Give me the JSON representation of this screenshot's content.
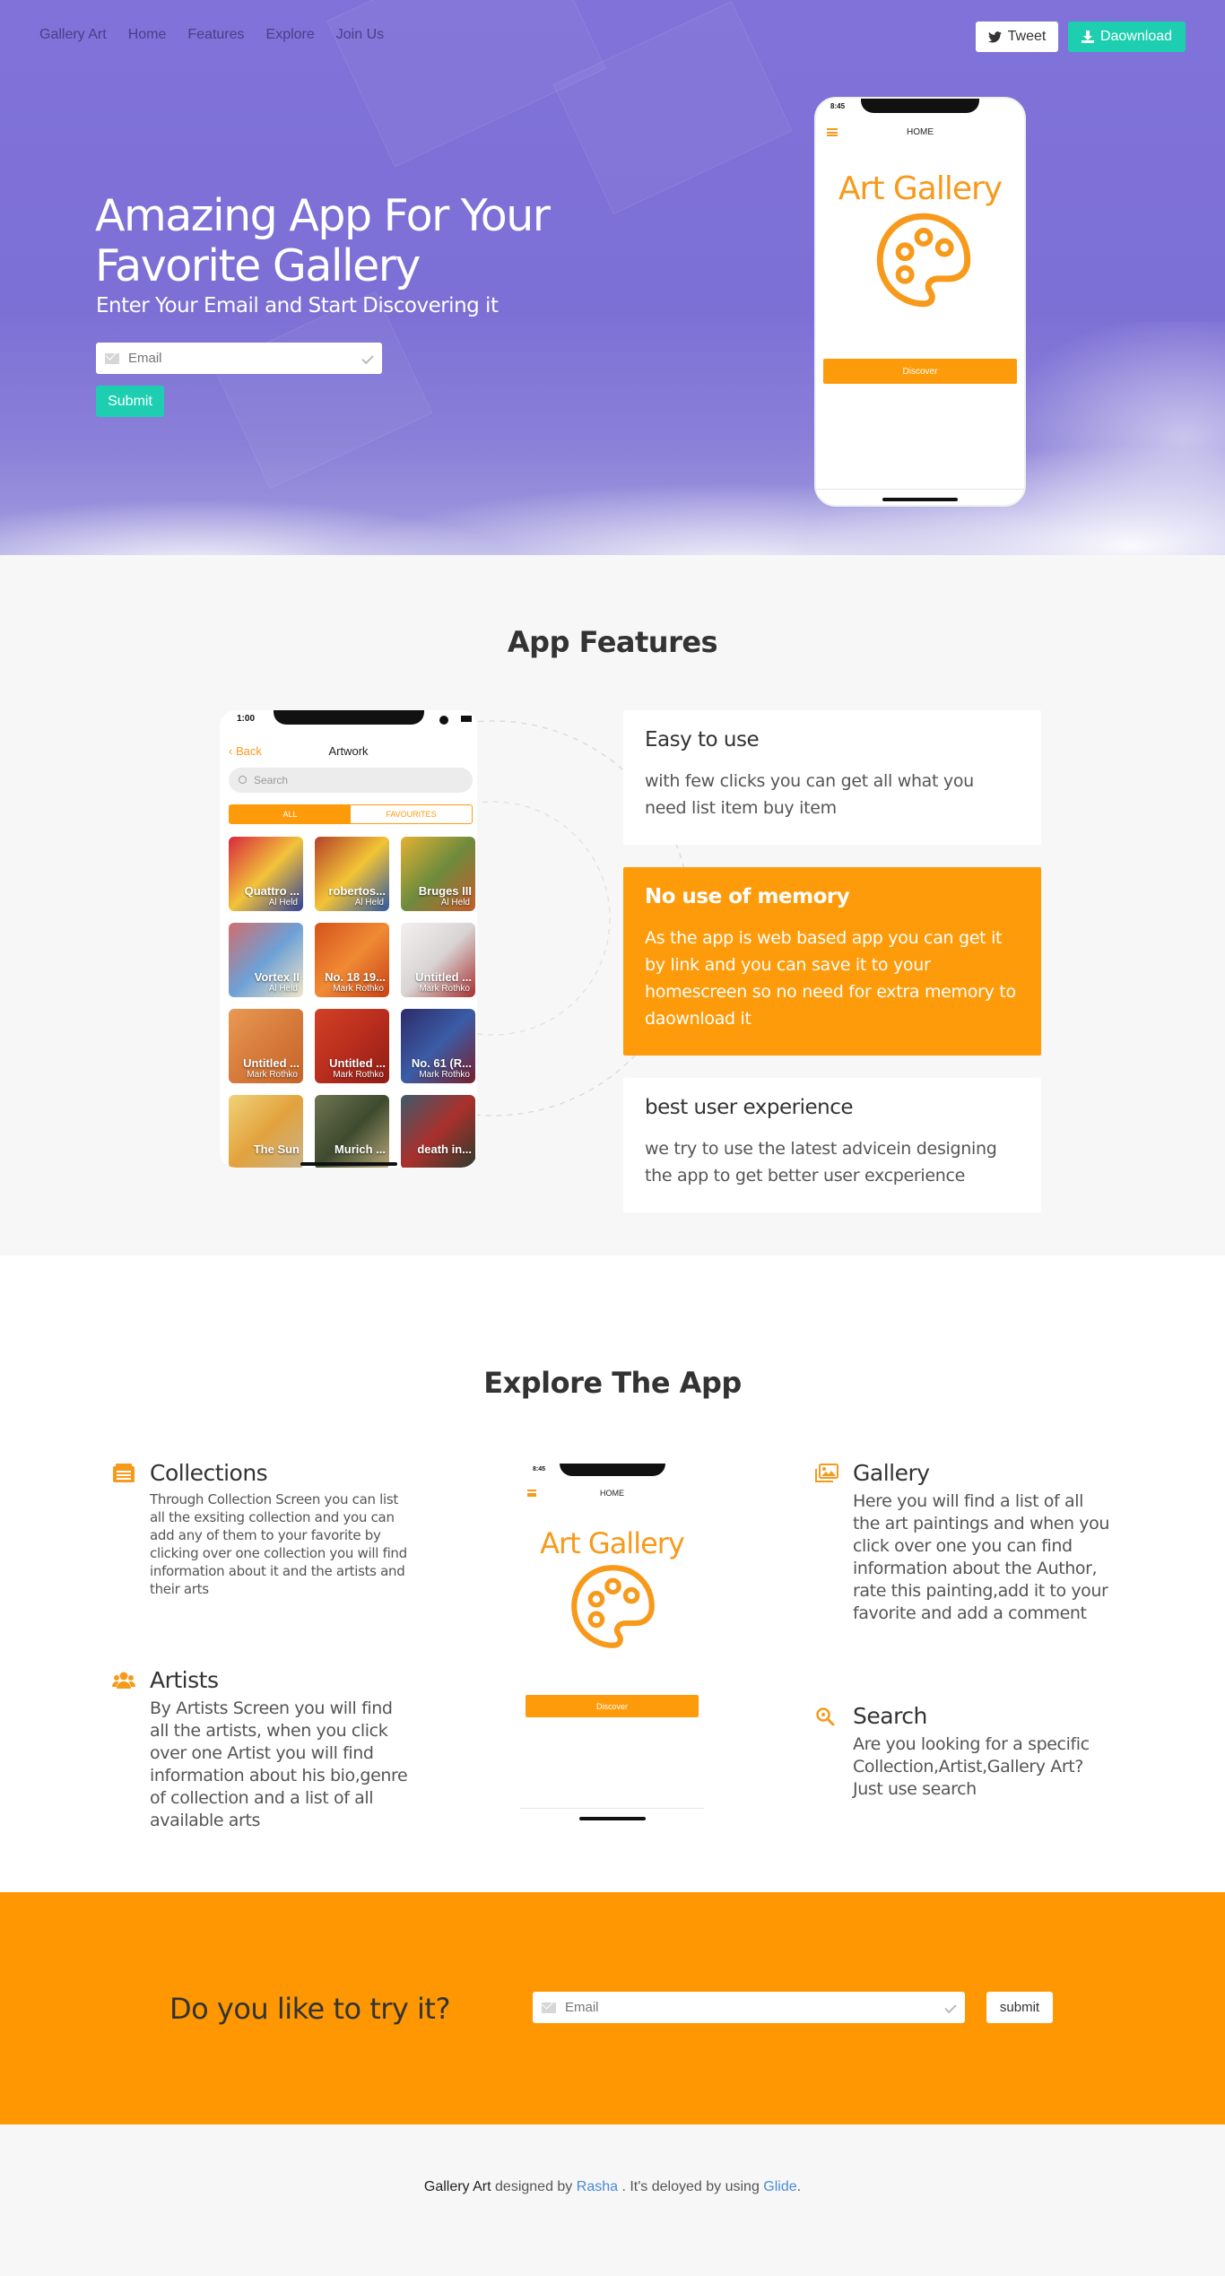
{
  "nav": {
    "brand": "Gallery Art",
    "links": [
      "Home",
      "Features",
      "Explore",
      "Join Us"
    ],
    "tweet_label": "Tweet",
    "download_label": "Daownload"
  },
  "hero": {
    "title": "Amazing App For Your Favorite Gallery",
    "subtitle": "Enter Your Email and Start Discovering it",
    "email_placeholder": "Email",
    "submit_label": "Submit",
    "phone": {
      "time": "8:45",
      "screen_title": "HOME",
      "brand": "Art Gallery",
      "button_label": "Discover"
    }
  },
  "features": {
    "title": "App Features",
    "phone": {
      "time": "1:00",
      "back_label": "Back",
      "screen_title": "Artwork",
      "search_placeholder": "Search",
      "segments": [
        "ALL",
        "FAVOURITES"
      ],
      "tiles": [
        {
          "title": "Quattro ...",
          "artist": "Al Held",
          "colors": [
            "#d7283c",
            "#f2c33a",
            "#2f3f9c"
          ]
        },
        {
          "title": "robertos...",
          "artist": "Al Held",
          "colors": [
            "#b4422a",
            "#f3c436",
            "#2d57a3"
          ]
        },
        {
          "title": "Bruges III",
          "artist": "Al Held",
          "colors": [
            "#e1b233",
            "#6e8b3d",
            "#c65b2b"
          ]
        },
        {
          "title": "Vortex II",
          "artist": "Al Held",
          "colors": [
            "#d06e6e",
            "#6da0d6",
            "#f0e6c6"
          ]
        },
        {
          "title": "No. 18 19...",
          "artist": "Mark Rothko",
          "colors": [
            "#d5531c",
            "#f08a34",
            "#c74117"
          ]
        },
        {
          "title": "Untitled ...",
          "artist": "Mark Rothko",
          "colors": [
            "#f3f0ef",
            "#d8d4d4",
            "#a8302f"
          ]
        },
        {
          "title": "Untitled ...",
          "artist": "Mark Rothko",
          "colors": [
            "#e99a55",
            "#d67b3b",
            "#c5642a"
          ]
        },
        {
          "title": "Untitled ...",
          "artist": "Mark Rothko",
          "colors": [
            "#d24125",
            "#b82d1d",
            "#8f1c16"
          ]
        },
        {
          "title": "No. 61 (R...",
          "artist": "Mark Rothko",
          "colors": [
            "#2e2b6a",
            "#3b5ca6",
            "#7a1f2c"
          ]
        },
        {
          "title": "The Sun",
          "artist": "",
          "colors": [
            "#f0d27a",
            "#e2a23d",
            "#c8b38a"
          ]
        },
        {
          "title": "Murich ...",
          "artist": "",
          "colors": [
            "#6e7550",
            "#3e4a2f",
            "#b9a97a"
          ]
        },
        {
          "title": "death in...",
          "artist": "",
          "colors": [
            "#3e5a6c",
            "#a9302c",
            "#2c3b2e"
          ]
        }
      ]
    },
    "cards": [
      {
        "title": "Easy to use",
        "body": "with few clicks you can get all what you need list item buy item"
      },
      {
        "title": "No use of memory",
        "body": "As the app is web based app you can get it by link and you can save it to your homescreen so no need for extra memory to daownload it"
      },
      {
        "title": "best user experience",
        "body": "we try to use the latest advicein designing the app to get better user excperience"
      }
    ]
  },
  "explore": {
    "title": "Explore The App",
    "items": {
      "collections": {
        "title": "Collections",
        "body": "Through Collection Screen you can list all the exsiting collection and you can add any of them to your favorite by clicking over one collection you will find information about it and the artists and their arts"
      },
      "artists": {
        "title": "Artists",
        "body": "By Artists Screen you will find all the artists, when you click over one Artist you will find information about his bio,genre of collection and a list of all available arts"
      },
      "gallery": {
        "title": "Gallery",
        "body": "Here you will find a list of all the art paintings and when you click over one you can find information about the Author, rate this painting,add it to your favorite and add a comment"
      },
      "search": {
        "title": "Search",
        "body": "Are you looking for a specific Collection,Artist,Gallery Art? Just use search"
      }
    },
    "phone": {
      "time": "8:45",
      "screen_title": "HOME",
      "brand": "Art Gallery",
      "button_label": "Discover"
    }
  },
  "cta": {
    "title": "Do you like to try it?",
    "email_placeholder": "Email",
    "submit_label": "submit"
  },
  "footer": {
    "brand": "Gallery Art",
    "designed_by": "designed by",
    "author": "Rasha",
    "deployed_text": ". It's deloyed by using",
    "platform": "Glide",
    "end": "."
  },
  "colors": {
    "hero_purple": "#7c6fd5",
    "accent_orange": "#fe9b0a",
    "accent_teal": "#1dcfb0",
    "link_blue": "#4a8ad8"
  }
}
